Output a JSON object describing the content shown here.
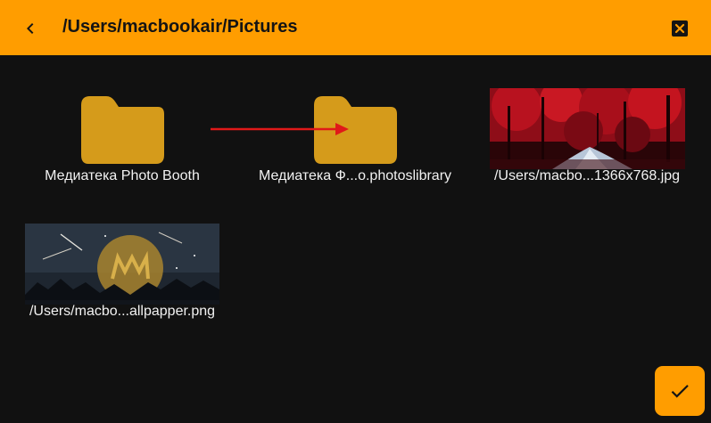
{
  "header": {
    "title": "/Users/macbookair/Pictures",
    "back_icon": "chevron-left-icon",
    "close_icon": "close-box-icon",
    "background_color": "#ff9d00"
  },
  "items": [
    {
      "type": "folder",
      "label": "Медиатека Photo Booth",
      "icon": "folder-icon"
    },
    {
      "type": "folder",
      "label": "Медиатека Ф...o.photoslibrary",
      "icon": "folder-icon"
    },
    {
      "type": "image",
      "label": "/Users/macbo...1366x768.jpg",
      "thumbnail": "red-forest-road"
    },
    {
      "type": "image",
      "label": "/Users/macbo...allpapper.png",
      "thumbnail": "night-mountains-logo"
    }
  ],
  "confirm_button": {
    "icon": "checkmark-icon",
    "color": "#ff9d00"
  },
  "colors": {
    "accent": "#ff9d00",
    "folder": "#d59b1b",
    "background": "#111111",
    "annotation_arrow": "#e01919"
  }
}
